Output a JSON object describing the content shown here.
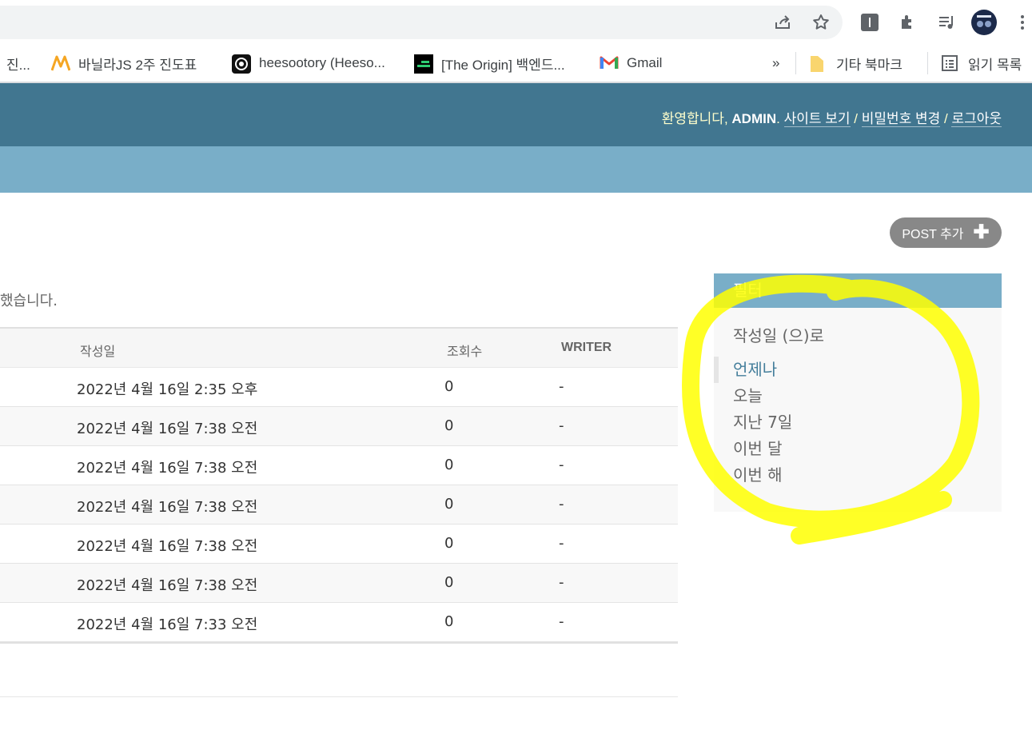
{
  "bookmarks": {
    "items": [
      {
        "label": "진...",
        "icon": "bookmark-icon"
      },
      {
        "label": "바닐라JS 2주 진도표",
        "icon": "nomad-logo-icon"
      },
      {
        "label": "heesootory (Heeso...",
        "icon": "swirl-logo-icon"
      },
      {
        "label": "[The Origin] 백엔드...",
        "icon": "origin-logo-icon"
      },
      {
        "label": "Gmail",
        "icon": "gmail-icon"
      }
    ],
    "more": "»",
    "other_label": "기타 북마크",
    "reading_list_label": "읽기 목록"
  },
  "header": {
    "welcome": "환영합니다, ",
    "username": "ADMIN",
    "dot": ". ",
    "view_site": "사이트 보기",
    "sep1": " / ",
    "change_password": "비밀번호 변경",
    "sep2": " / ",
    "logout": "로그아웃"
  },
  "object_tools": {
    "add_label": "POST 추가",
    "add_icon": "plus-icon"
  },
  "message": "했습니다.",
  "table": {
    "headers": {
      "created": "작성일",
      "views": "조회수",
      "writer": "WRITER"
    },
    "rows": [
      {
        "created": "2022년 4월 16일 2:35 오후",
        "views": "0",
        "writer": "-"
      },
      {
        "created": "2022년 4월 16일 7:38 오전",
        "views": "0",
        "writer": "-"
      },
      {
        "created": "2022년 4월 16일 7:38 오전",
        "views": "0",
        "writer": "-"
      },
      {
        "created": "2022년 4월 16일 7:38 오전",
        "views": "0",
        "writer": "-"
      },
      {
        "created": "2022년 4월 16일 7:38 오전",
        "views": "0",
        "writer": "-"
      },
      {
        "created": "2022년 4월 16일 7:38 오전",
        "views": "0",
        "writer": "-"
      },
      {
        "created": "2022년 4월 16일 7:33 오전",
        "views": "0",
        "writer": "-"
      }
    ]
  },
  "filter": {
    "title": "필터",
    "subtitle": "작성일 (으)로",
    "options": [
      {
        "label": "언제나",
        "selected": true
      },
      {
        "label": "오늘",
        "selected": false
      },
      {
        "label": "지난 7일",
        "selected": false
      },
      {
        "label": "이번 달",
        "selected": false
      },
      {
        "label": "이번 해",
        "selected": false
      }
    ]
  },
  "colors": {
    "header": "#417690",
    "breadcrumbs": "#79aec8",
    "highlight": "#ffff00"
  }
}
